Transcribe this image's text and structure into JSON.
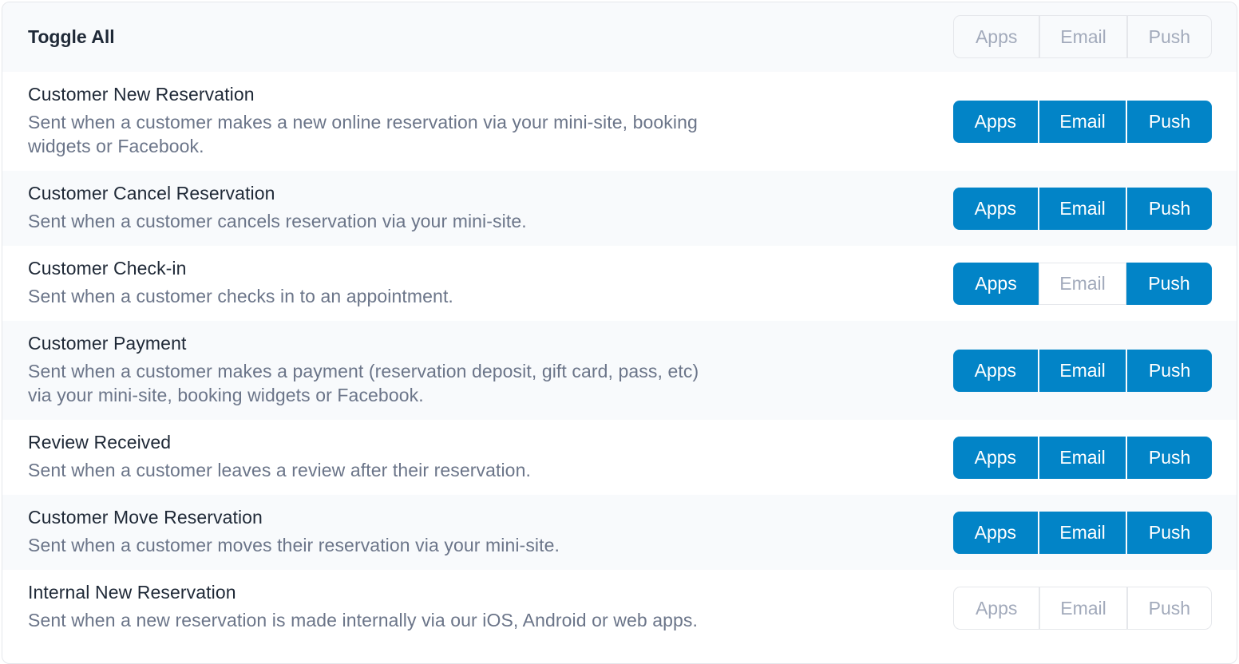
{
  "header": {
    "title": "Toggle All",
    "buttons": [
      {
        "label": "Apps",
        "active": false
      },
      {
        "label": "Email",
        "active": false
      },
      {
        "label": "Push",
        "active": false
      }
    ]
  },
  "colors": {
    "active": "#0284c7",
    "inactive_text": "#a2aabb",
    "title_text": "#1f2937",
    "description_text": "#6b7589"
  },
  "notifications": [
    {
      "title": "Customer New Reservation",
      "description_lines": [
        "Sent when a customer makes a new online reservation via your mini-site, booking",
        "widgets or Facebook."
      ],
      "buttons": [
        {
          "label": "Apps",
          "active": true
        },
        {
          "label": "Email",
          "active": true
        },
        {
          "label": "Push",
          "active": true
        }
      ]
    },
    {
      "title": "Customer Cancel Reservation",
      "description_lines": [
        "Sent when a customer cancels reservation via your mini-site."
      ],
      "buttons": [
        {
          "label": "Apps",
          "active": true
        },
        {
          "label": "Email",
          "active": true
        },
        {
          "label": "Push",
          "active": true
        }
      ]
    },
    {
      "title": "Customer Check-in",
      "description_lines": [
        "Sent when a customer checks in to an appointment."
      ],
      "buttons": [
        {
          "label": "Apps",
          "active": true
        },
        {
          "label": "Email",
          "active": false
        },
        {
          "label": "Push",
          "active": true
        }
      ]
    },
    {
      "title": "Customer Payment",
      "description_lines": [
        "Sent when a customer makes a payment (reservation deposit, gift card, pass, etc)",
        "via your mini-site, booking widgets or Facebook."
      ],
      "buttons": [
        {
          "label": "Apps",
          "active": true
        },
        {
          "label": "Email",
          "active": true
        },
        {
          "label": "Push",
          "active": true
        }
      ]
    },
    {
      "title": "Review Received",
      "description_lines": [
        "Sent when a customer leaves a review after their reservation."
      ],
      "buttons": [
        {
          "label": "Apps",
          "active": true
        },
        {
          "label": "Email",
          "active": true
        },
        {
          "label": "Push",
          "active": true
        }
      ]
    },
    {
      "title": "Customer Move Reservation",
      "description_lines": [
        "Sent when a customer moves their reservation via your mini-site."
      ],
      "buttons": [
        {
          "label": "Apps",
          "active": true
        },
        {
          "label": "Email",
          "active": true
        },
        {
          "label": "Push",
          "active": true
        }
      ]
    },
    {
      "title": "Internal New Reservation",
      "description_lines": [
        "Sent when a new reservation is made internally via our iOS, Android or web apps."
      ],
      "buttons": [
        {
          "label": "Apps",
          "active": false
        },
        {
          "label": "Email",
          "active": false
        },
        {
          "label": "Push",
          "active": false
        }
      ]
    }
  ]
}
